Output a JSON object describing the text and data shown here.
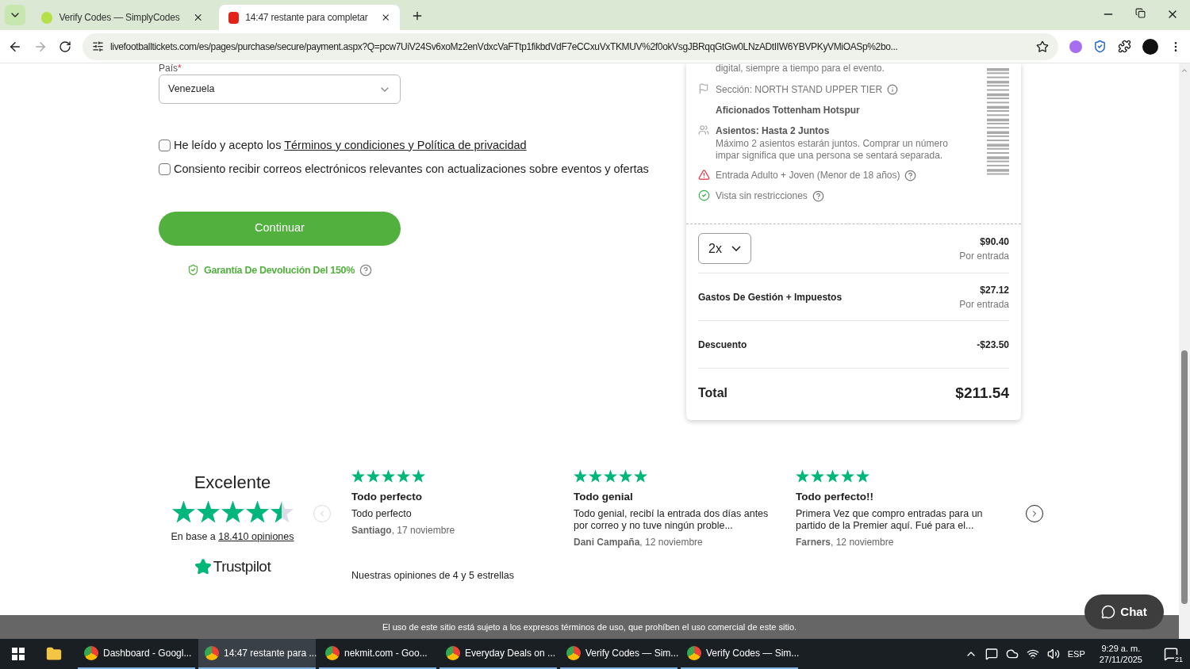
{
  "browser": {
    "tabs": [
      {
        "title": "Verify Codes — SimplyCodes",
        "selected": false
      },
      {
        "title": "14:47 restante para completar",
        "selected": true
      }
    ],
    "url": "livefootballtickets.com/es/pages/purchase/secure/payment.aspx?Q=pcw7UiV24Sv6xoMz2enVdxcVaFTtp1fikbdVdF7eCCxuVxTKMUV%2f0okVsgJBRqqGtGw0LNzADtIIW6YBVPKyVMiOASp%2bo..."
  },
  "form": {
    "country_label": "País",
    "required_mark": "*",
    "country_value": "Venezuela",
    "consents": [
      {
        "text_before": "He leído y acepto los ",
        "link": "Términos y condiciones y Política de privacidad",
        "checked": false
      },
      {
        "text_before": "Consiento recibir correos electrónicos relevantes con actualizaciones sobre eventos y ofertas",
        "checked": false
      }
    ],
    "continue_button": "Continuar",
    "guarantee": "Garantía De Devolución Del 150%"
  },
  "summary": {
    "intro": "digital, siempre a tiempo para el evento.",
    "features": [
      {
        "kind": "section",
        "text": "Sección: NORTH STAND UPPER TIER"
      },
      {
        "kind": "subtitle",
        "text": "Aficionados Tottenham Hotspur"
      },
      {
        "kind": "seats",
        "text": "Asientos: Hasta 2 Juntos",
        "detail": "Máximo 2 asientos estarán juntos. Comprar un número impar significa que una persona se sentará separada."
      },
      {
        "kind": "warning",
        "text": "Entrada Adulto + Joven (Menor de 18 años)"
      },
      {
        "kind": "check",
        "text": "Vista sin restricciones"
      }
    ],
    "quantity": "2x",
    "price": "$90.40",
    "price_note": "Por entrada",
    "lines": [
      {
        "label": "Gastos De Gestión + Impuestos",
        "value": "$27.12",
        "note": "Por entrada"
      },
      {
        "label": "Descuento",
        "value": "-$23.50"
      }
    ],
    "total_label": "Total",
    "total_value": "$211.54"
  },
  "trust": {
    "rating_word": "Excelente",
    "stars": 4.5,
    "based_on": "En base a ",
    "count_link": "18.410 opiniones",
    "brand": "Trustpilot",
    "footnote": "Nuestras opiniones de 4 y 5 estrellas",
    "reviews": [
      {
        "stars": 5,
        "title": "Todo perfecto",
        "body": "Todo perfecto",
        "author": "Santiago",
        "date": ", 17 noviembre"
      },
      {
        "stars": 5,
        "title": "Todo genial",
        "body": "Todo genial, recibí la entrada dos días antes por correo y no tuve ningún proble...",
        "author": "Dani Campaña",
        "date": ", 12 noviembre"
      },
      {
        "stars": 5,
        "title": "Todo perfecto!!",
        "body": "Primera Vez que compro entradas para un partido de la Premier aquí. Fué para el...",
        "author": "Farners",
        "date": ", 12 noviembre"
      }
    ]
  },
  "footer_text": "El uso de este sitio está sujeto a los expresos términos de uso, que prohíben el uso comercial de este sitio.",
  "chat_button": "Chat",
  "taskbar": {
    "apps": [
      {
        "title": "Dashboard - Googl...",
        "selected": false
      },
      {
        "title": "14:47 restante para ...",
        "selected": true
      },
      {
        "title": "nekmit.com - Goo...",
        "selected": false
      },
      {
        "title": "Everyday Deals on ...",
        "selected": false
      },
      {
        "title": "Verify Codes — Sim...",
        "selected": false
      },
      {
        "title": "Verify Codes — Sim...",
        "selected": false
      }
    ],
    "language": "ESP",
    "time": "9:29 a. m.",
    "date": "27/11/2025",
    "notifications": "21"
  }
}
